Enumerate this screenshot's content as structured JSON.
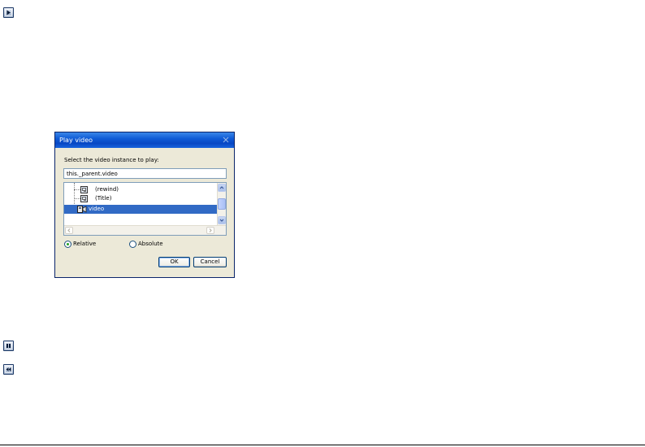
{
  "dialog": {
    "title": "Play video",
    "prompt": "Select the video instance to play:",
    "path_value": "this._parent.video",
    "tree": [
      {
        "label": "(rewind)",
        "selected": false
      },
      {
        "label": "(Title)",
        "selected": false
      },
      {
        "label": "video",
        "selected": true
      }
    ],
    "radios": {
      "relative": {
        "label": "Relative",
        "checked": true
      },
      "absolute": {
        "label": "Absolute",
        "checked": false
      }
    },
    "ok_label": "OK",
    "cancel_label": "Cancel"
  },
  "media_buttons": [
    {
      "name": "play",
      "icon": "play-icon"
    },
    {
      "name": "pause",
      "icon": "pause-icon"
    },
    {
      "name": "rewind",
      "icon": "rewind-icon"
    }
  ],
  "colors": {
    "titlebar": "#0847c4",
    "selection": "#316ac5",
    "dialog_face": "#ece9d8",
    "media_border": "#1e3a66"
  }
}
